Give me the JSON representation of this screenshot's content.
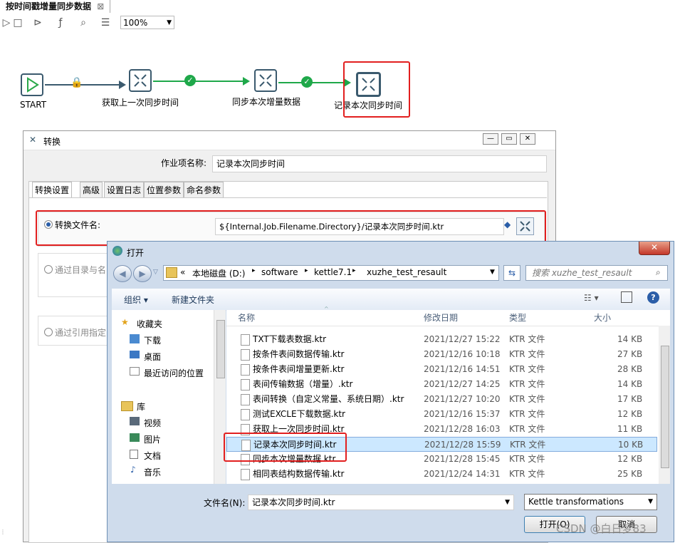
{
  "document_tab": {
    "title": "按时间戳增量同步数据",
    "close": "⊠"
  },
  "toolbar": {
    "zoom": "100%"
  },
  "canvas": {
    "start_label": "START",
    "steps": [
      "获取上一次同步时间",
      "同步本次增量数据",
      "记录本次同步时间"
    ]
  },
  "job_dialog": {
    "title": "转换",
    "name_label": "作业项名称:",
    "name_value": "记录本次同步时间",
    "tabs": [
      "转换设置",
      "高级",
      "设置日志",
      "位置参数",
      "命名参数"
    ],
    "option_filename_label": "转换文件名:",
    "option_filename_value": "${Internal.Job.Filename.Directory}/记录本次同步时间.ktr",
    "option_dir_label": "通过目录与名",
    "option_ref_label": "通过引用指定"
  },
  "open_dialog": {
    "title": "打开",
    "breadcrumb": [
      "«",
      "本地磁盘 (D:)",
      "software",
      "kettle7.1",
      "xuzhe_test_resault"
    ],
    "search_placeholder": "搜索 xuzhe_test_resault",
    "organize": "组织 ▾",
    "new_folder": "新建文件夹",
    "nav": {
      "favorites": "收藏夹",
      "fav_items": [
        "下载",
        "桌面",
        "最近访问的位置"
      ],
      "libraries": "库",
      "lib_items": [
        "视频",
        "图片",
        "文档",
        "音乐"
      ]
    },
    "columns": {
      "name": "名称",
      "date": "修改日期",
      "type": "类型",
      "size": "大小"
    },
    "partial_row": "",
    "files": [
      {
        "name": "TXT下载表数据.ktr",
        "date": "2021/12/27 15:22",
        "type": "KTR 文件",
        "size": "14 KB"
      },
      {
        "name": "按条件表间数据传输.ktr",
        "date": "2021/12/16 10:18",
        "type": "KTR 文件",
        "size": "27 KB"
      },
      {
        "name": "按条件表间增量更新.ktr",
        "date": "2021/12/16 14:51",
        "type": "KTR 文件",
        "size": "28 KB"
      },
      {
        "name": "表间传输数据（增量）.ktr",
        "date": "2021/12/27 14:25",
        "type": "KTR 文件",
        "size": "14 KB"
      },
      {
        "name": "表间转换（自定义常量、系统日期）.ktr",
        "date": "2021/12/27 10:20",
        "type": "KTR 文件",
        "size": "17 KB"
      },
      {
        "name": "测试EXCLE下载数据.ktr",
        "date": "2021/12/16 15:37",
        "type": "KTR 文件",
        "size": "12 KB"
      },
      {
        "name": "获取上一次同步时间.ktr",
        "date": "2021/12/28 16:03",
        "type": "KTR 文件",
        "size": "11 KB"
      },
      {
        "name": "记录本次同步时间.ktr",
        "date": "2021/12/28 15:59",
        "type": "KTR 文件",
        "size": "10 KB"
      },
      {
        "name": "同步本次增量数据.ktr",
        "date": "2021/12/28 15:45",
        "type": "KTR 文件",
        "size": "12 KB"
      },
      {
        "name": "相同表结构数据传输.ktr",
        "date": "2021/12/24 14:31",
        "type": "KTR 文件",
        "size": "25 KB"
      }
    ],
    "filename_label": "文件名(N):",
    "filename_value": "记录本次同步时间.ktr",
    "filetype_value": "Kettle transformations",
    "open_button": "打开(O)",
    "cancel_button": "取消"
  },
  "watermark": "CSDN @白日梦83",
  "colors": {
    "accent": "#e21f1f",
    "hop": "#1fa84a",
    "node_border": "#3b5a6e",
    "selected_row": "#cce8ff"
  }
}
